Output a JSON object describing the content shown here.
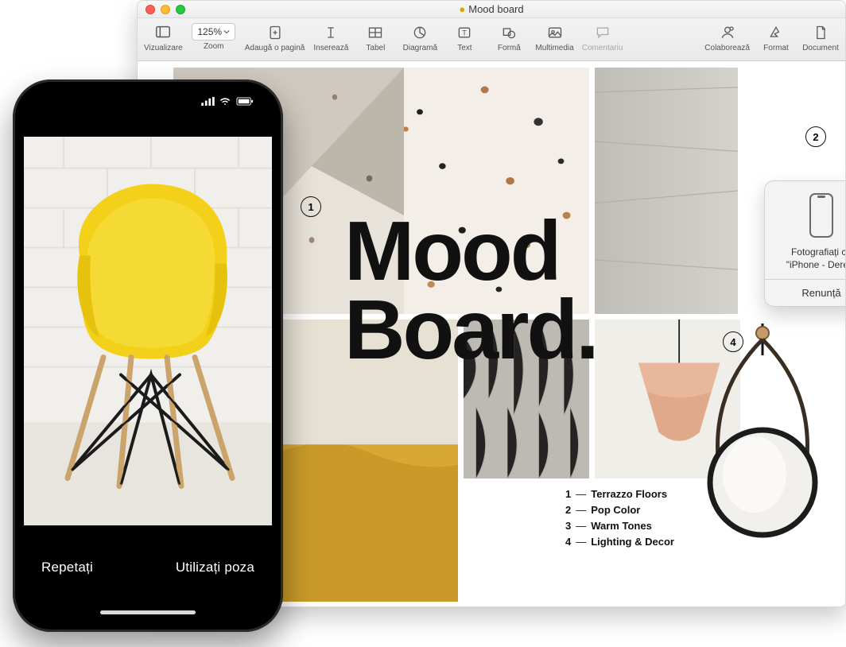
{
  "window": {
    "title": "Mood board"
  },
  "toolbar": {
    "view": "Vizualizare",
    "zoom_value": "125%",
    "zoom": "Zoom",
    "add_page": "Adaugă o pagină",
    "insert": "Inserează",
    "table": "Tabel",
    "chart": "Diagramă",
    "text": "Text",
    "shape": "Formă",
    "media": "Multimedia",
    "comment": "Comentariu",
    "collaborate": "Colaborează",
    "format": "Format",
    "document": "Document"
  },
  "headline_l1": "Mood",
  "headline_l2": "Board.",
  "markers": {
    "m1": "1",
    "m2": "2",
    "m4": "4"
  },
  "legend": [
    {
      "n": "1",
      "label": "Terrazzo Floors"
    },
    {
      "n": "2",
      "label": "Pop Color"
    },
    {
      "n": "3",
      "label": "Warm Tones"
    },
    {
      "n": "4",
      "label": "Lighting & Decor"
    }
  ],
  "popover": {
    "line1": "Fotografiați cu",
    "line2": "\"iPhone - Derek\"",
    "cancel": "Renunță"
  },
  "iphone": {
    "retake": "Repetați",
    "use": "Utilizați poza"
  }
}
